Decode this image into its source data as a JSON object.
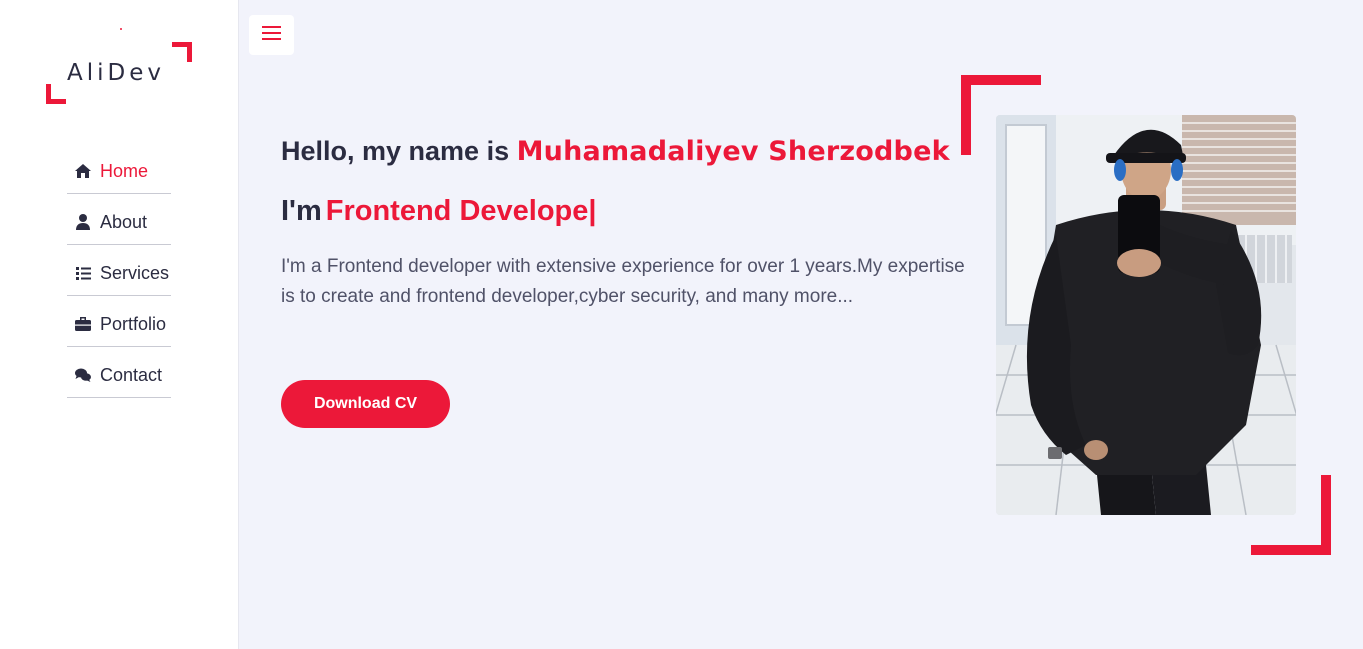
{
  "logo": {
    "text": "AliDev"
  },
  "nav": {
    "items": [
      {
        "label": "Home",
        "icon": "home-icon",
        "active": true
      },
      {
        "label": "About",
        "icon": "user-icon",
        "active": false
      },
      {
        "label": "Services",
        "icon": "list-icon",
        "active": false
      },
      {
        "label": "Portfolio",
        "icon": "briefcase-icon",
        "active": false
      },
      {
        "label": "Contact",
        "icon": "comments-icon",
        "active": false
      }
    ]
  },
  "hero": {
    "greeting": "Hello, my name is",
    "name": "Muhamadaliyev Sherzodbek",
    "role_prefix": "I'm",
    "role": "Frontend Develope",
    "cursor": "|",
    "description": "I'm a Frontend developer with extensive experience for over 1 years.My expertise is to create and frontend developer,cyber security, and many more...",
    "cta_label": "Download CV"
  },
  "colors": {
    "accent": "#ec1839",
    "text": "#2b2c41",
    "background": "#f2f3fb",
    "sidebar": "#ffffff"
  },
  "icons": {
    "menu": "hamburger-menu-icon"
  }
}
